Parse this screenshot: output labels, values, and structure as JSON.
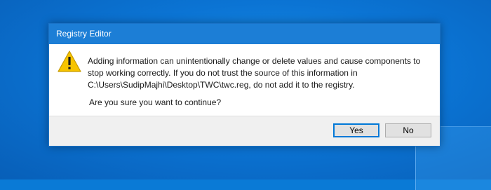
{
  "dialog": {
    "title": "Registry Editor",
    "message_lines": [
      "Adding information can unintentionally change or delete values and cause components to",
      "stop working correctly. If you do not trust the source of this information in",
      "C:\\Users\\SudipMajhi\\Desktop\\TWC\\twc.reg, do not add it to the registry."
    ],
    "question": "Are you sure you want to continue?",
    "icon": "warning-icon",
    "buttons": {
      "yes": "Yes",
      "no": "No"
    }
  },
  "colors": {
    "titlebar": "#1c7ed6",
    "desktop": "#0b74d4",
    "warning_fill": "#f7c400",
    "default_button_border": "#0078d7"
  }
}
